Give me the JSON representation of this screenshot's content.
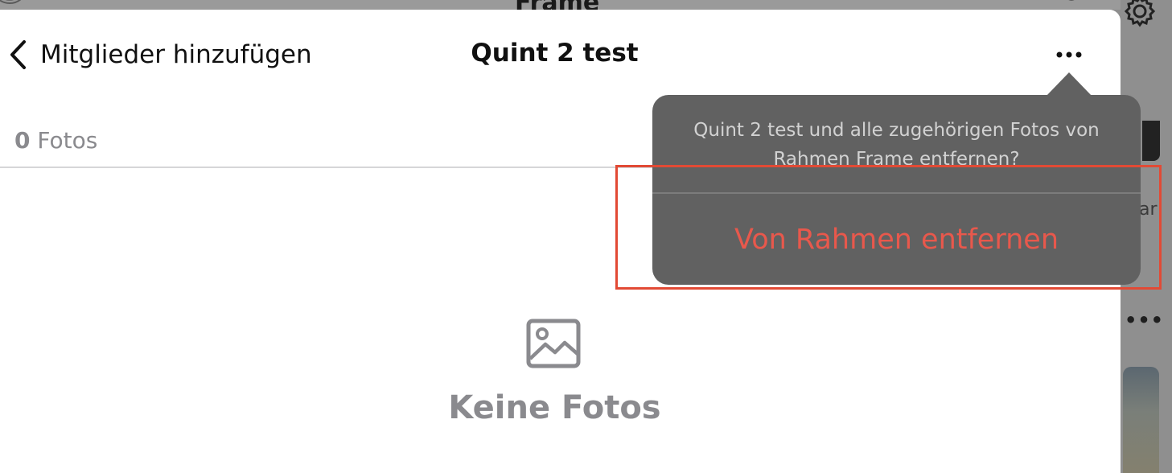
{
  "background": {
    "title": "Frame",
    "partial_text": "ar",
    "more_glyph": "•••",
    "icons": [
      "search-icon",
      "gear-icon"
    ]
  },
  "sheet": {
    "back_label": "Mitglieder hinzufügen",
    "title": "Quint 2 test",
    "photo_count": {
      "number": "0",
      "label": "Fotos"
    },
    "empty_state": {
      "icon": "photo-icon",
      "label": "Keine Fotos"
    },
    "icons": [
      "chevron-left-icon",
      "more-icon"
    ]
  },
  "popover": {
    "message": "Quint 2 test und alle zugehörigen Fotos von Rahmen Frame entfernen?",
    "action_label": "Von Rahmen entfernen",
    "action_color": "#e8584c",
    "background_color": "#616161"
  },
  "highlight": {
    "color": "#e24a35"
  }
}
